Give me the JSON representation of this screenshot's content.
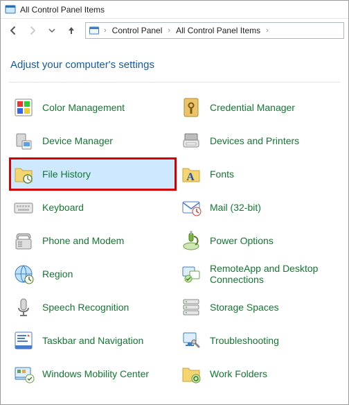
{
  "window": {
    "title": "All Control Panel Items"
  },
  "breadcrumb": {
    "root": "Control Panel",
    "current": "All Control Panel Items"
  },
  "heading": "Adjust your computer's settings",
  "items": [
    {
      "label": "Color Management",
      "icon": "color-management-icon"
    },
    {
      "label": "Credential Manager",
      "icon": "credential-manager-icon"
    },
    {
      "label": "Device Manager",
      "icon": "device-manager-icon"
    },
    {
      "label": "Devices and Printers",
      "icon": "devices-printers-icon"
    },
    {
      "label": "File History",
      "icon": "file-history-icon",
      "highlight": true
    },
    {
      "label": "Fonts",
      "icon": "fonts-icon"
    },
    {
      "label": "Keyboard",
      "icon": "keyboard-icon"
    },
    {
      "label": "Mail (32-bit)",
      "icon": "mail-icon"
    },
    {
      "label": "Phone and Modem",
      "icon": "phone-modem-icon"
    },
    {
      "label": "Power Options",
      "icon": "power-options-icon"
    },
    {
      "label": "Region",
      "icon": "region-icon"
    },
    {
      "label": "RemoteApp and Desktop Connections",
      "icon": "remoteapp-icon"
    },
    {
      "label": "Speech Recognition",
      "icon": "speech-icon"
    },
    {
      "label": "Storage Spaces",
      "icon": "storage-spaces-icon"
    },
    {
      "label": "Taskbar and Navigation",
      "icon": "taskbar-icon"
    },
    {
      "label": "Troubleshooting",
      "icon": "troubleshooting-icon"
    },
    {
      "label": "Windows Mobility Center",
      "icon": "mobility-center-icon"
    },
    {
      "label": "Work Folders",
      "icon": "work-folders-icon"
    }
  ]
}
